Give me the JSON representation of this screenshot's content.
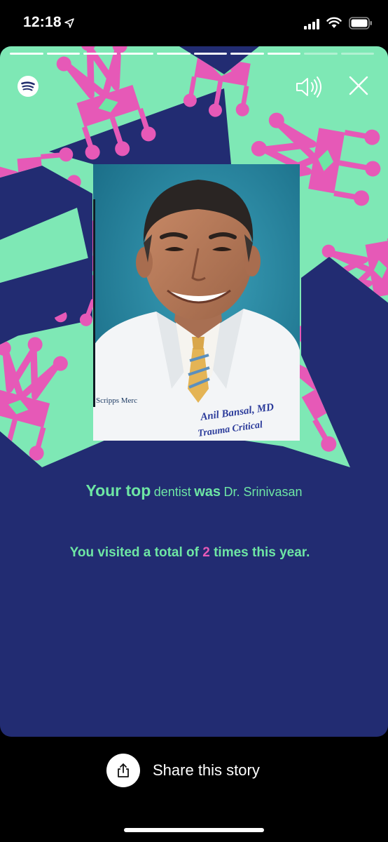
{
  "status_bar": {
    "time": "12:18",
    "icons": [
      "location-arrow-icon",
      "cellular-signal-icon",
      "wifi-icon",
      "battery-icon"
    ]
  },
  "story": {
    "progress": {
      "total_segments": 10,
      "completed_segments": 8
    },
    "brand_icon": "spotify-icon",
    "controls": {
      "sound_icon": "speaker-icon",
      "close_icon": "close-icon"
    },
    "photo": {
      "caption_left": "Scripps Merc",
      "coat_text_line1": "Anil Bansal, MD",
      "coat_text_line2": "Trauma Critical"
    },
    "headline": {
      "part1": "Your top",
      "part2": "dentist",
      "part3": "was",
      "part4": "Dr. Srinivasan"
    },
    "visits": {
      "prefix": "You visited a total of",
      "count": "2",
      "suffix": "times this year."
    }
  },
  "share": {
    "label": "Share this story",
    "icon": "share-icon"
  },
  "colors": {
    "background": "#222c72",
    "mint": "#6ee6a4",
    "pink": "#e659b7",
    "white": "#ffffff"
  }
}
